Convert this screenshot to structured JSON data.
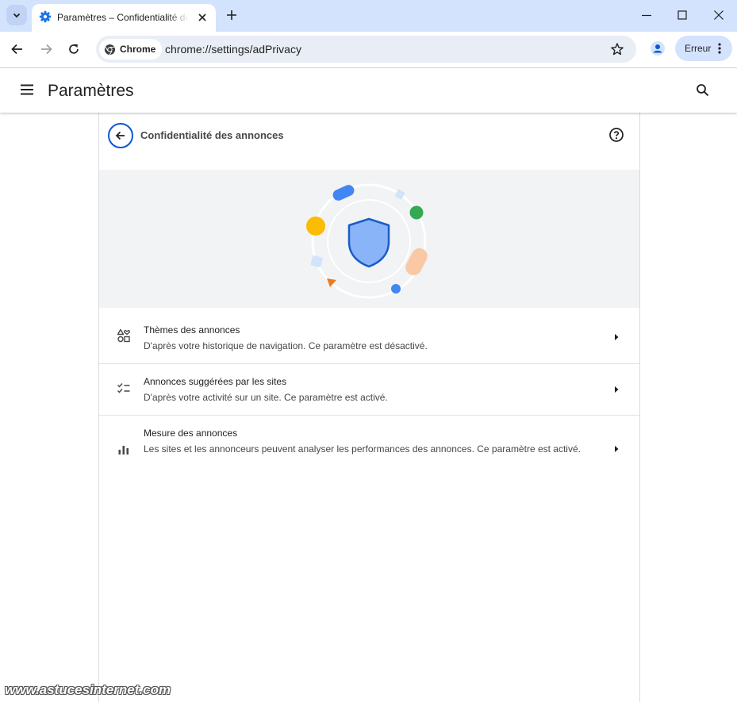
{
  "browser": {
    "tab_title": "Paramètres – Confidentialité des annonces",
    "address_chip": "Chrome",
    "url": "chrome://settings/adPrivacy",
    "profile_error_label": "Erreur"
  },
  "settings": {
    "page_title": "Paramètres",
    "section_title": "Confidentialité des annonces"
  },
  "rows": [
    {
      "title": "Thèmes des annonces",
      "description": "D'après votre historique de navigation. Ce paramètre est désactivé."
    },
    {
      "title": "Annonces suggérées par les sites",
      "description": "D'après votre activité sur un site. Ce paramètre est activé."
    },
    {
      "title": "Mesure des annonces",
      "description": "Les sites et les annonceurs peuvent analyser les performances des annonces. Ce paramètre est activé."
    }
  ],
  "watermark": "www.astucesinternet.com",
  "colors": {
    "tabstrip_bg": "#d3e3fd",
    "accent_blue": "#0b57d0",
    "banner_bg": "#f1f3f4",
    "shield_fill": "#8ab4f8",
    "shield_stroke": "#1a5cc8",
    "yellow_dot": "#fbbc04",
    "green_dot": "#34a853",
    "orange_triangle": "#f07b1f",
    "peach_pill": "#f9c9a6"
  },
  "icons": {
    "tab_search": "chevron-down-icon",
    "tab_favicon": "gear-icon",
    "back": "arrow-left-icon",
    "forward": "arrow-right-icon",
    "reload": "reload-icon",
    "bookmark": "star-icon",
    "profile": "person-icon",
    "menu": "hamburger-icon",
    "search": "search-icon",
    "help": "help-circle-icon",
    "row_topics": "shapes-icon",
    "row_suggested": "checklist-icon",
    "row_measurement": "bar-chart-icon",
    "row_arrow": "caret-right-icon"
  }
}
